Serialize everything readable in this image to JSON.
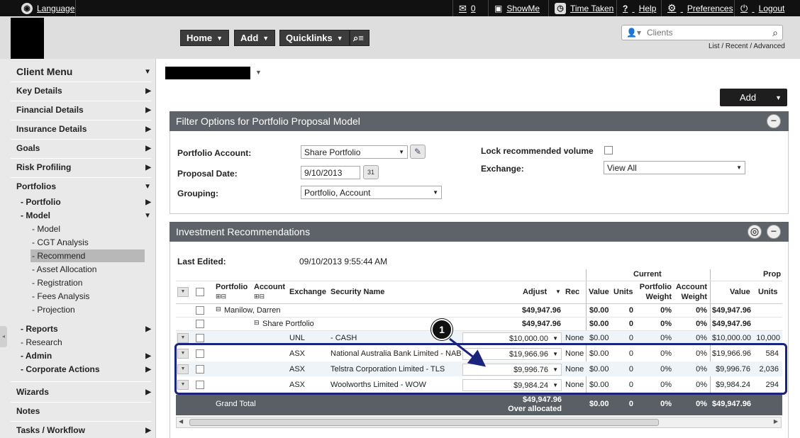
{
  "topbar": {
    "language": "Language",
    "messages_count": "0",
    "showme": "ShowMe",
    "time_taken": "Time Taken",
    "help": "Help",
    "preferences": "Preferences",
    "logout": "Logout"
  },
  "nav": {
    "home": "Home",
    "add": "Add",
    "quicklinks": "Quicklinks"
  },
  "search": {
    "placeholder": "Clients",
    "links": "List / Recent / Advanced"
  },
  "sidebar": {
    "title": "Client Menu",
    "items": [
      {
        "label": "Key Details"
      },
      {
        "label": "Financial Details"
      },
      {
        "label": "Insurance Details"
      },
      {
        "label": "Goals"
      },
      {
        "label": "Risk Profiling"
      },
      {
        "label": "Portfolios"
      },
      {
        "label": "- Portfolio"
      },
      {
        "label": "- Model"
      },
      {
        "label": "- Model"
      },
      {
        "label": "- CGT Analysis"
      },
      {
        "label": "- Recommend"
      },
      {
        "label": "- Asset Allocation"
      },
      {
        "label": "- Registration"
      },
      {
        "label": "- Fees Analysis"
      },
      {
        "label": "- Projection"
      },
      {
        "label": "- Reports"
      },
      {
        "label": "- Research"
      },
      {
        "label": "- Admin"
      },
      {
        "label": "- Corporate Actions"
      },
      {
        "label": "Wizards"
      },
      {
        "label": "Notes"
      },
      {
        "label": "Tasks / Workflow"
      }
    ]
  },
  "main": {
    "add_button": "Add",
    "filter_title": "Filter Options for Portfolio Proposal Model",
    "portfolio_account_label": "Portfolio Account:",
    "portfolio_account_value": "Share Portfolio",
    "proposal_date_label": "Proposal Date:",
    "proposal_date_value": "9/10/2013",
    "grouping_label": "Grouping:",
    "grouping_value": "Portfolio, Account",
    "lock_label": "Lock recommended volume",
    "exchange_label": "Exchange:",
    "exchange_value": "View All",
    "inv_title": "Investment Recommendations",
    "last_edited_label": "Last Edited:",
    "last_edited_value": "09/10/2013 9:55:44 AM"
  },
  "table": {
    "group_current": "Current",
    "group_prop": "Prop",
    "headers": {
      "portfolio": "Portfolio",
      "account": "Account",
      "exchange": "Exchange",
      "security": "Security Name",
      "adjust": "Adjust",
      "rec": "Rec",
      "value": "Value",
      "units": "Units",
      "pweight1": "Portfolio",
      "pweight2": "Weight",
      "aweight1": "Account",
      "aweight2": "Weight",
      "pvalue": "Value",
      "punits": "Units"
    },
    "rows": [
      {
        "portfolio": "Manilow, Darren",
        "account": "",
        "exchange": "",
        "security": "",
        "adjust": "$49,947.96",
        "rec": "",
        "value": "$0.00",
        "units": "0",
        "pw": "0%",
        "aw": "0%",
        "pvalue": "$49,947.96",
        "punits": ""
      },
      {
        "portfolio": "",
        "account": "Share Portfolio",
        "exchange": "",
        "security": "",
        "adjust": "$49,947.96",
        "rec": "",
        "value": "$0.00",
        "units": "0",
        "pw": "0%",
        "aw": "0%",
        "pvalue": "$49,947.96",
        "punits": ""
      },
      {
        "portfolio": "",
        "account": "",
        "exchange": "UNL",
        "security": "- CASH",
        "adjust": "$10,000.00",
        "rec": "None",
        "value": "$0.00",
        "units": "0",
        "pw": "0%",
        "aw": "0%",
        "pvalue": "$10,000.00",
        "punits": "10,000"
      },
      {
        "portfolio": "",
        "account": "",
        "exchange": "ASX",
        "security": "National Australia Bank Limited - NAB",
        "adjust": "$19,966.96",
        "rec": "None",
        "value": "$0.00",
        "units": "0",
        "pw": "0%",
        "aw": "0%",
        "pvalue": "$19,966.96",
        "punits": "584"
      },
      {
        "portfolio": "",
        "account": "",
        "exchange": "ASX",
        "security": "Telstra Corporation Limited - TLS",
        "adjust": "$9,996.76",
        "rec": "None",
        "value": "$0.00",
        "units": "0",
        "pw": "0%",
        "aw": "0%",
        "pvalue": "$9,996.76",
        "punits": "2,036"
      },
      {
        "portfolio": "",
        "account": "",
        "exchange": "ASX",
        "security": "Woolworths Limited - WOW",
        "adjust": "$9,984.24",
        "rec": "None",
        "value": "$0.00",
        "units": "0",
        "pw": "0%",
        "aw": "0%",
        "pvalue": "$9,984.24",
        "punits": "294"
      }
    ],
    "total": {
      "label": "Grand Total",
      "adjust": "$49,947.96",
      "note": "Over allocated",
      "value": "$0.00",
      "units": "0",
      "pw": "0%",
      "aw": "0%",
      "pvalue": "$49,947.96"
    }
  },
  "callout": "1"
}
